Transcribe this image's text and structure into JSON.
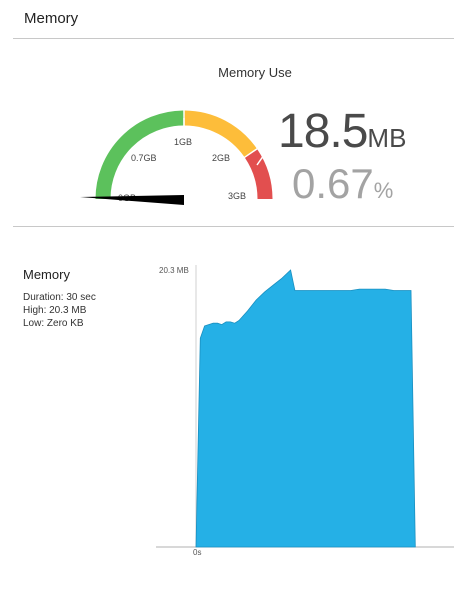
{
  "header": {
    "title": "Memory"
  },
  "gauge": {
    "title": "Memory Use",
    "value": "18.5",
    "value_unit": "MB",
    "percent": "0.67",
    "percent_unit": "%",
    "ticks": [
      "0GB",
      "0.7GB",
      "1GB",
      "2GB",
      "3GB"
    ],
    "colors": {
      "green": "#5cc15c",
      "yellow": "#fdbd3a",
      "red": "#e24f4f"
    }
  },
  "history": {
    "title": "Memory",
    "duration_line": "Duration: 30 sec",
    "high_line": "High: 20.3 MB",
    "low_line": "Low: Zero KB"
  },
  "chart_data": {
    "type": "area",
    "y_max_label": "20.3 MB",
    "x_start_label": "0s",
    "ylim": [
      0,
      20.3
    ],
    "xlim": [
      0,
      30
    ],
    "color": "#25b0e6",
    "x": [
      0,
      0.5,
      1,
      2,
      2.5,
      3,
      3.5,
      4,
      4.5,
      5,
      6,
      7,
      8,
      9,
      10,
      11,
      11.5,
      12.5,
      13.5,
      14.5,
      15,
      16,
      17,
      18,
      19,
      20,
      21,
      22,
      23,
      24,
      25,
      25.5
    ],
    "y": [
      0,
      15.3,
      16.2,
      16.4,
      16.4,
      16.3,
      16.5,
      16.5,
      16.4,
      16.6,
      17.3,
      18.1,
      18.7,
      19.2,
      19.7,
      20.3,
      18.8,
      18.8,
      18.8,
      18.8,
      18.8,
      18.8,
      18.8,
      18.8,
      18.9,
      18.9,
      18.9,
      18.9,
      18.8,
      18.8,
      18.8,
      0
    ]
  }
}
